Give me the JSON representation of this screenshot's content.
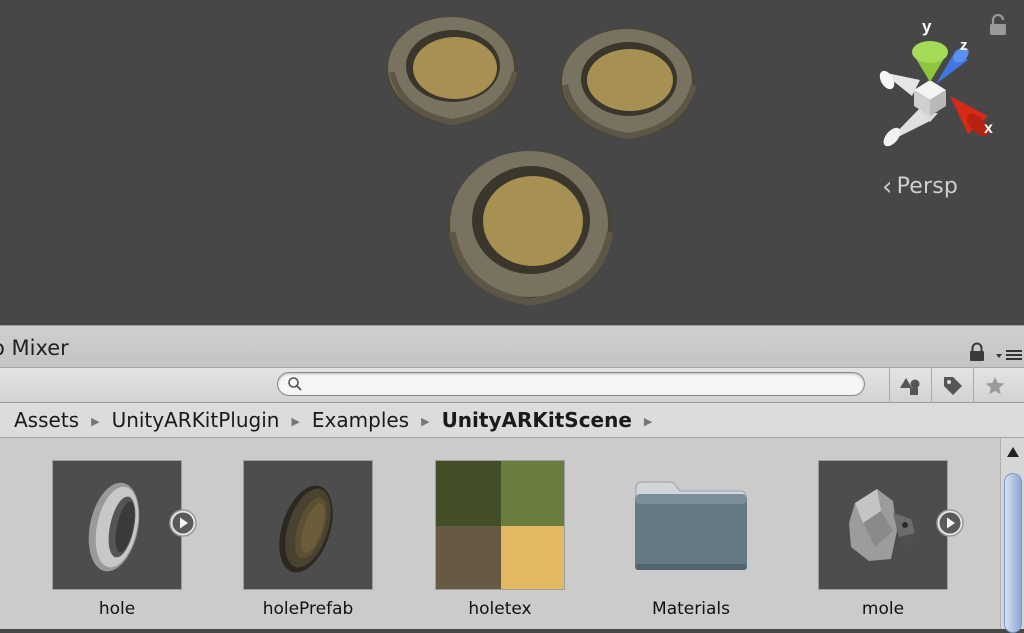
{
  "scene": {
    "projection_label": "Persp",
    "axes": {
      "x": "x",
      "y": "y",
      "z": "z"
    }
  },
  "panel": {
    "title": "o Mixer"
  },
  "search": {
    "value": "",
    "placeholder": ""
  },
  "breadcrumb": [
    {
      "label": "Assets"
    },
    {
      "label": "UnityARKitPlugin"
    },
    {
      "label": "Examples"
    },
    {
      "label": "UnityARKitScene"
    }
  ],
  "assets": [
    {
      "label": "hole",
      "icon": "hole-model-icon",
      "expandable": true
    },
    {
      "label": "holePrefab",
      "icon": "prefab-icon",
      "expandable": false
    },
    {
      "label": "holetex",
      "icon": "texture-icon",
      "expandable": false
    },
    {
      "label": "Materials",
      "icon": "folder-icon",
      "expandable": false
    },
    {
      "label": "mole",
      "icon": "mole-model-icon",
      "expandable": true
    }
  ],
  "colors": {
    "scene_bg": "#474747",
    "hole_rim": "#6e6654",
    "hole_inner": "#a88f52",
    "gizmo_x": "#d42a16",
    "gizmo_y": "#9bd24a",
    "gizmo_z": "#3f78e0",
    "texture_quadrants": [
      "#434d26",
      "#6a7c3e",
      "#675a45",
      "#e3b863"
    ]
  }
}
